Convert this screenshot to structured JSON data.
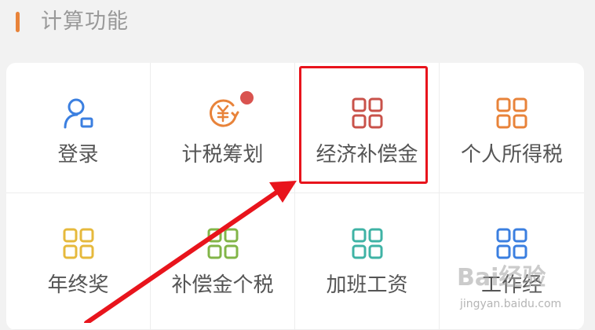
{
  "section": {
    "title": "计算功能",
    "accent_color": "#e8833a"
  },
  "grid_items": [
    {
      "label": "登录",
      "icon": "user-login-icon",
      "color": "#3b7fe0"
    },
    {
      "label": "计税筹划",
      "icon": "yuan-cycle-icon",
      "color": "#e8833a",
      "badge_color": "#d9534f"
    },
    {
      "label": "经济补偿金",
      "icon": "grid-apps-icon",
      "color": "#c9524a"
    },
    {
      "label": "个人所得税",
      "icon": "grid-apps-icon",
      "color": "#e8833a"
    },
    {
      "label": "年终奖",
      "icon": "grid-apps-icon",
      "color": "#e6b93c"
    },
    {
      "label": "补偿金个税",
      "icon": "grid-apps-icon",
      "color": "#82b548"
    },
    {
      "label": "加班工资",
      "icon": "grid-apps-icon",
      "color": "#3fb3a5"
    },
    {
      "label": "工作经",
      "icon": "grid-apps-icon",
      "color": "#3b7fe0"
    }
  ],
  "annotation": {
    "highlight_color": "#e8141c",
    "arrow_color": "#e8141c"
  },
  "watermark": {
    "main": "Bai经验",
    "sub": "jingyan.baidu.com"
  }
}
